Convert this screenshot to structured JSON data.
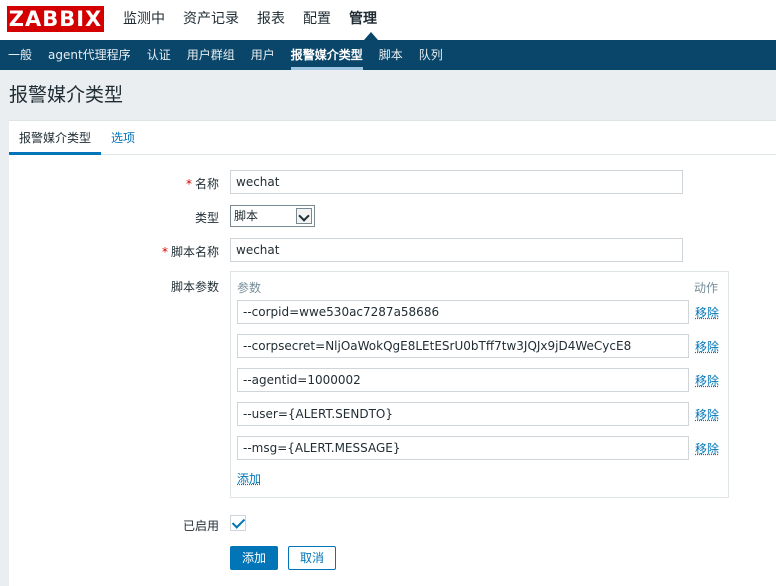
{
  "brand": {
    "logo_text": "ZABBIX",
    "color": "#d40000"
  },
  "top_nav": [
    "监测中",
    "资产记录",
    "报表",
    "配置",
    "管理"
  ],
  "sub_nav": [
    "一般",
    "agent代理程序",
    "认证",
    "用户群组",
    "用户",
    "报警媒介类型",
    "脚本",
    "队列"
  ],
  "page_title": "报警媒介类型",
  "tabs": [
    "报警媒介类型",
    "选项"
  ],
  "form": {
    "name_label": "名称",
    "name_value": "wechat",
    "type_label": "类型",
    "type_value": "脚本",
    "script_name_label": "脚本名称",
    "script_name_value": "wechat",
    "script_params_label": "脚本参数",
    "params_header": "参数",
    "actions_header": "动作",
    "params": [
      "--corpid=wwe530ac7287a58686",
      "--corpsecret=NljOaWokQgE8LEtESrU0bTff7tw3JQJx9jD4WeCycE8",
      "--agentid=1000002",
      "--user={ALERT.SENDTO}",
      "--msg={ALERT.MESSAGE}"
    ],
    "remove_label": "移除",
    "add_label": "添加",
    "enabled_label": "已启用",
    "enabled": true,
    "submit_label": "添加",
    "cancel_label": "取消"
  },
  "colors": {
    "accent": "#0275b8",
    "nav_bg": "#0a466a",
    "required": "#d40000"
  },
  "icons": [
    "check-icon",
    "chevron-down-icon"
  ]
}
